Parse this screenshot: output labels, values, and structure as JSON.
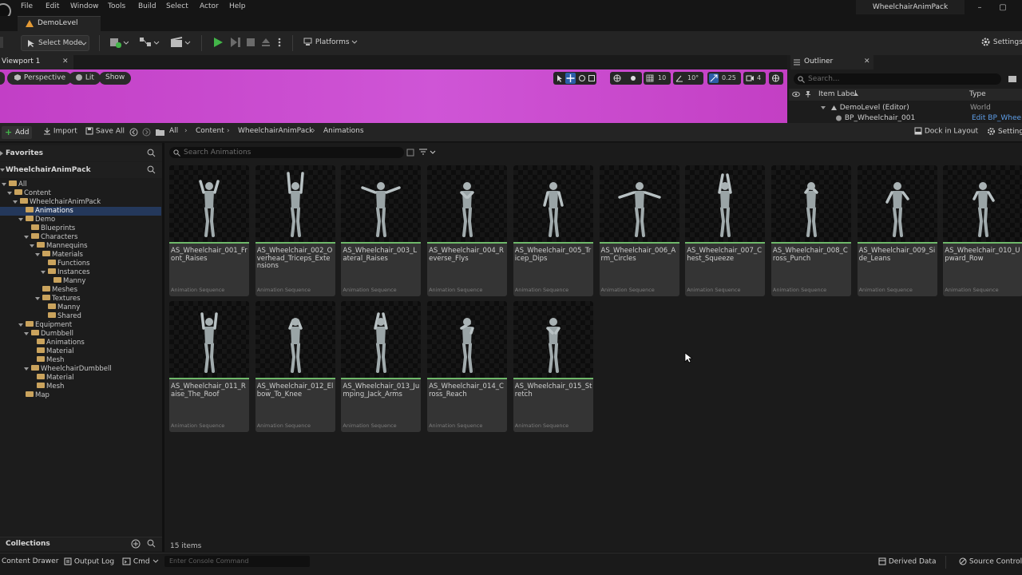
{
  "menu": [
    "File",
    "Edit",
    "Window",
    "Tools",
    "Build",
    "Select",
    "Actor",
    "Help"
  ],
  "project_title": "WheelchairAnimPack",
  "level_tab": "DemoLevel",
  "toolbar": {
    "select_mode": "Select Mode",
    "platforms": "Platforms",
    "settings": "Settings"
  },
  "viewport": {
    "tab": "Viewport 1",
    "perspective": "Perspective",
    "lit": "Lit",
    "show": "Show",
    "grid_snap": "10",
    "rot_snap": "10°",
    "scale_snap": "0.25",
    "camera_speed": "4"
  },
  "outliner": {
    "tab": "Outliner",
    "search_placeholder": "Search...",
    "col_label": "Item Label",
    "col_type": "Type",
    "rows": [
      {
        "label": "DemoLevel (Editor)",
        "type": "World"
      },
      {
        "label": "BP_Wheelchair_001",
        "type": "Edit BP_Wheelchai"
      }
    ]
  },
  "content_browser": {
    "add": "Add",
    "import": "Import",
    "save_all": "Save All",
    "breadcrumb": [
      "All",
      "Content",
      "WheelchairAnimPack",
      "Animations"
    ],
    "dock": "Dock in Layout",
    "settings": "Settings",
    "favorites": "Favorites",
    "pack_header": "WheelchairAnimPack",
    "search_placeholder": "Search Animations",
    "collections": "Collections",
    "item_count": "15 items",
    "tree": [
      {
        "label": "All",
        "depth": 0,
        "arrow": true
      },
      {
        "label": "Content",
        "depth": 1,
        "arrow": true
      },
      {
        "label": "WheelchairAnimPack",
        "depth": 2,
        "arrow": true
      },
      {
        "label": "Animations",
        "depth": 3,
        "arrow": false
      },
      {
        "label": "Demo",
        "depth": 3,
        "arrow": true
      },
      {
        "label": "Blueprints",
        "depth": 4,
        "arrow": false
      },
      {
        "label": "Characters",
        "depth": 4,
        "arrow": true
      },
      {
        "label": "Mannequins",
        "depth": 5,
        "arrow": true
      },
      {
        "label": "Materials",
        "depth": 6,
        "arrow": true
      },
      {
        "label": "Functions",
        "depth": 7,
        "arrow": false
      },
      {
        "label": "Instances",
        "depth": 7,
        "arrow": true
      },
      {
        "label": "Manny",
        "depth": 8,
        "arrow": false
      },
      {
        "label": "Meshes",
        "depth": 6,
        "arrow": false
      },
      {
        "label": "Textures",
        "depth": 6,
        "arrow": true
      },
      {
        "label": "Manny",
        "depth": 7,
        "arrow": false
      },
      {
        "label": "Shared",
        "depth": 7,
        "arrow": false
      },
      {
        "label": "Equipment",
        "depth": 3,
        "arrow": true
      },
      {
        "label": "Dumbbell",
        "depth": 4,
        "arrow": true
      },
      {
        "label": "Animations",
        "depth": 5,
        "arrow": false
      },
      {
        "label": "Material",
        "depth": 5,
        "arrow": false
      },
      {
        "label": "Mesh",
        "depth": 5,
        "arrow": false
      },
      {
        "label": "WheelchairDumbbell",
        "depth": 4,
        "arrow": true
      },
      {
        "label": "Material",
        "depth": 5,
        "arrow": false
      },
      {
        "label": "Mesh",
        "depth": 5,
        "arrow": false
      },
      {
        "label": "Map",
        "depth": 3,
        "arrow": false
      }
    ],
    "selected_folder": "Animations",
    "asset_type": "Animation Sequence",
    "assets": [
      "AS_Wheelchair_001_Front_Raises",
      "AS_Wheelchair_002_Overhead_Triceps_Extensions",
      "AS_Wheelchair_003_Lateral_Raises",
      "AS_Wheelchair_004_Reverse_Flys",
      "AS_Wheelchair_005_Tricep_Dips",
      "AS_Wheelchair_006_Arm_Circles",
      "AS_Wheelchair_007_Chest_Squeeze",
      "AS_Wheelchair_008_Cross_Punch",
      "AS_Wheelchair_009_Side_Leans",
      "AS_Wheelchair_010_Upward_Row",
      "AS_Wheelchair_011_Raise_The_Roof",
      "AS_Wheelchair_012_Elbow_To_Knee",
      "AS_Wheelchair_013_Jumping_Jack_Arms",
      "AS_Wheelchair_014_Cross_Reach",
      "AS_Wheelchair_015_Stretch"
    ]
  },
  "statusbar": {
    "content_drawer": "Content Drawer",
    "output_log": "Output Log",
    "cmd": "Cmd",
    "console_placeholder": "Enter Console Command",
    "derived_data": "Derived Data",
    "source_control": "Source Control O"
  },
  "colors": {
    "viewport_bg": "#c94ccf",
    "selection": "#24385b",
    "folder": "#caa35d",
    "anim_underline": "#6fb86a",
    "play": "#43b549"
  }
}
